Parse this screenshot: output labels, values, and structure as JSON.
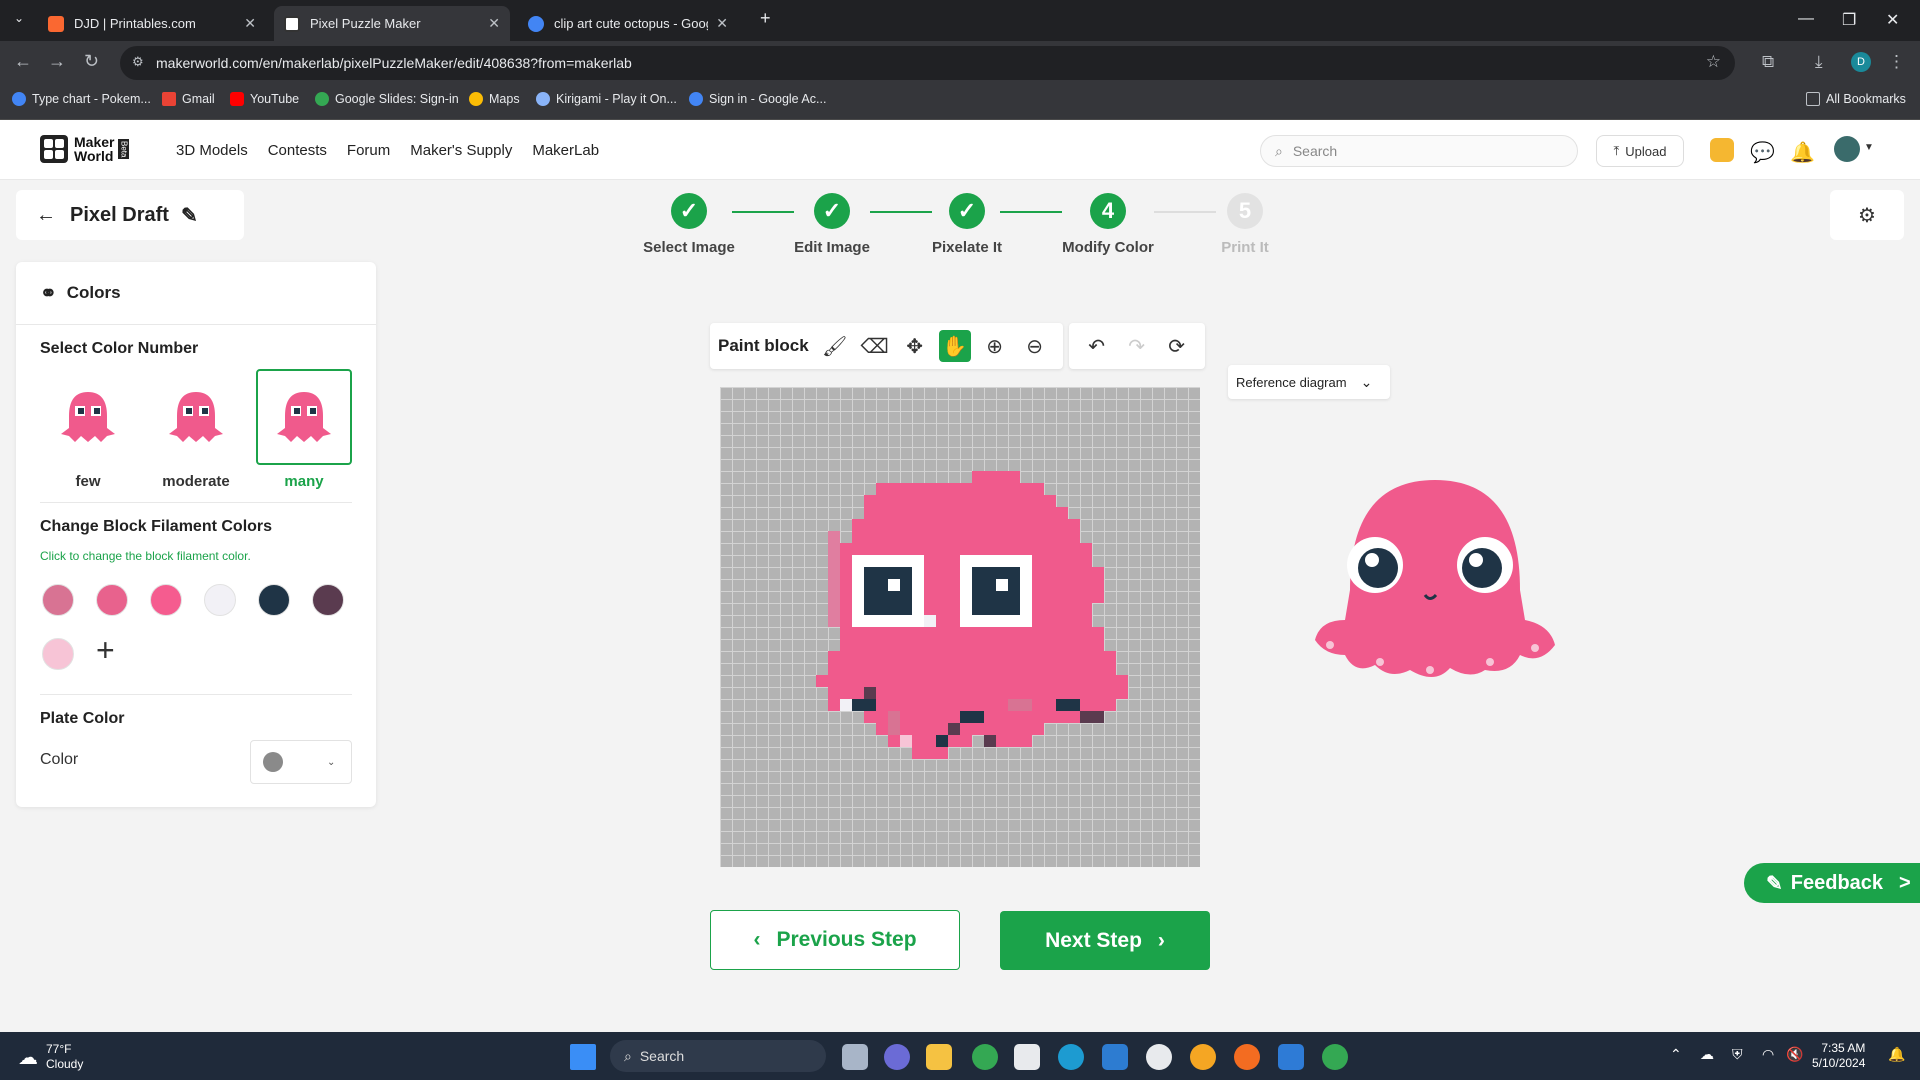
{
  "browser": {
    "tabs": [
      {
        "title": "DJD | Printables.com",
        "color": "#fa6831"
      },
      {
        "title": "Pixel Puzzle Maker",
        "color": "#ffffff"
      },
      {
        "title": "clip art cute octopus - Google S",
        "color": "#4285f4"
      }
    ],
    "url": "makerworld.com/en/makerlab/pixelPuzzleMaker/edit/408638?from=makerlab",
    "profile_initial": "D",
    "bookmarks": [
      {
        "label": "Type chart - Pokem...",
        "color": "#4285f4"
      },
      {
        "label": "Gmail",
        "color": "#ea4335"
      },
      {
        "label": "YouTube",
        "color": "#ff0000"
      },
      {
        "label": "Google Slides: Sign-in",
        "color": "#34a853"
      },
      {
        "label": "Maps",
        "color": "#fbbc05"
      },
      {
        "label": "Kirigami - Play it On...",
        "color": "#8ab4f8"
      },
      {
        "label": "Sign in - Google Ac...",
        "color": "#4285f4"
      }
    ],
    "all_bookmarks": "All Bookmarks"
  },
  "header": {
    "logo_line1": "Maker",
    "logo_line2": "World",
    "logo_badge": "Beta",
    "menu": [
      "3D Models",
      "Contests",
      "Forum",
      "Maker's Supply",
      "MakerLab"
    ],
    "search_placeholder": "Search",
    "upload": "Upload"
  },
  "draft": {
    "title": "Pixel Draft"
  },
  "steps": [
    {
      "num": "✓",
      "label": "Select Image",
      "state": "done"
    },
    {
      "num": "✓",
      "label": "Edit Image",
      "state": "done"
    },
    {
      "num": "✓",
      "label": "Pixelate It",
      "state": "done"
    },
    {
      "num": "4",
      "label": "Modify Color",
      "state": "current"
    },
    {
      "num": "5",
      "label": "Print It",
      "state": "todo"
    }
  ],
  "panel": {
    "title": "Colors",
    "select_color_number": "Select Color Number",
    "options": [
      "few",
      "moderate",
      "many"
    ],
    "selected_option": "many",
    "change_title": "Change Block Filament Colors",
    "change_hint": "Click to change the block filament color.",
    "swatches": [
      "#d87393",
      "#e8628d",
      "#f55c8f",
      "#f2f1f6",
      "#1f3446",
      "#5a3b4f",
      "#f7c4d6"
    ],
    "plate_title": "Plate Color",
    "color_label": "Color",
    "plate_color": "#8a8a8a"
  },
  "toolbar": {
    "paint_label": "Paint block",
    "active_tool": "hand"
  },
  "reference": {
    "label": "Reference diagram"
  },
  "buttons": {
    "prev": "Previous Step",
    "next": "Next Step",
    "feedback": "Feedback"
  },
  "taskbar": {
    "weather_temp": "77°F",
    "weather_desc": "Cloudy",
    "search": "Search",
    "time": "7:35 AM",
    "date": "5/10/2024"
  },
  "colors": {
    "accent": "#1ba34a"
  }
}
